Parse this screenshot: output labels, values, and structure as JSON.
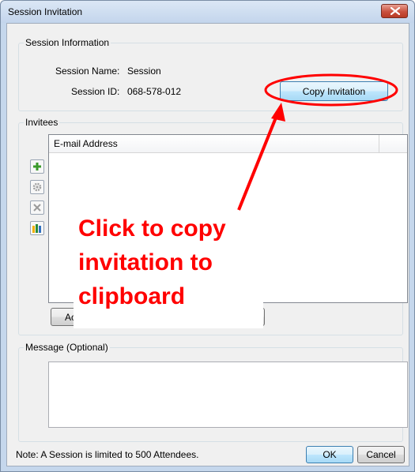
{
  "window": {
    "title": "Session Invitation",
    "close_icon": "close-icon"
  },
  "session_info": {
    "group_label": "Session Information",
    "name_label": "Session Name:",
    "name_value": "Session",
    "id_label": "Session ID:",
    "id_value": "068-578-012",
    "copy_button": "Copy Invitation"
  },
  "invitees": {
    "group_label": "Invitees",
    "column_header": "E-mail Address",
    "toolbar_icons": [
      "add-icon",
      "settings-icon",
      "delete-icon",
      "people-icon"
    ],
    "hidden_button_fragment": "Ac"
  },
  "message": {
    "group_label": "Message (Optional)",
    "value": ""
  },
  "footer": {
    "note": "Note: A Session is limited to 500 Attendees.",
    "ok_button": "OK",
    "cancel_button": "Cancel"
  },
  "annotation": {
    "lines": [
      "Click to copy",
      "invitation to",
      "clipboard"
    ],
    "color": "#ff0000"
  }
}
